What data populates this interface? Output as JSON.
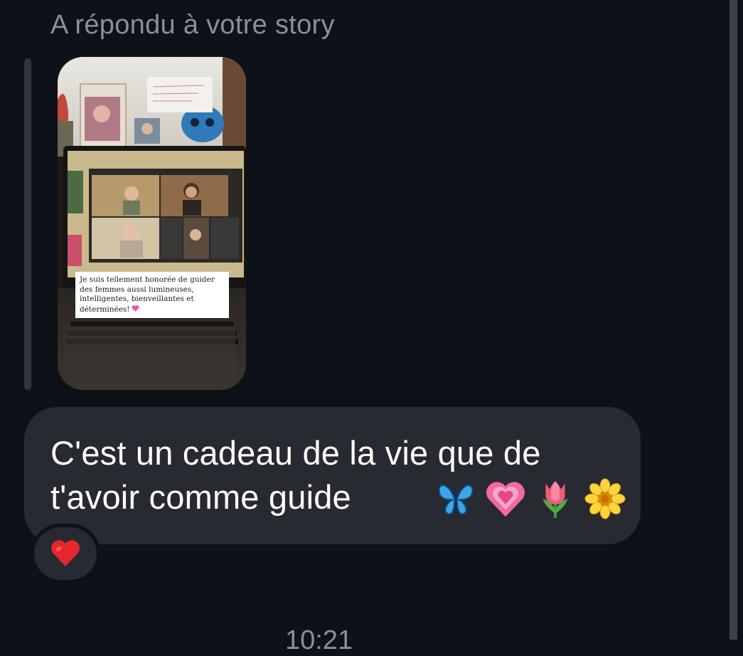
{
  "reply_header": "A répondu à votre story",
  "story": {
    "caption": "Je suis tellement honorée de guider des femmes aussi lumineuses, intelligentes, bienveillantes et déterminées!",
    "caption_emoji": "pink-heart-icon"
  },
  "message": {
    "text_line1": "C'est un cadeau de la vie que de",
    "text_line2": "t'avoir comme guide",
    "emojis": [
      "butterfly-icon",
      "growing-heart-icon",
      "tulip-icon",
      "blossom-icon"
    ]
  },
  "reaction": {
    "emoji": "red-heart-icon"
  },
  "timestamp": "10:21",
  "colors": {
    "background": "#0d1118",
    "bubble": "#272a31",
    "secondary_text": "#8c8f95"
  }
}
